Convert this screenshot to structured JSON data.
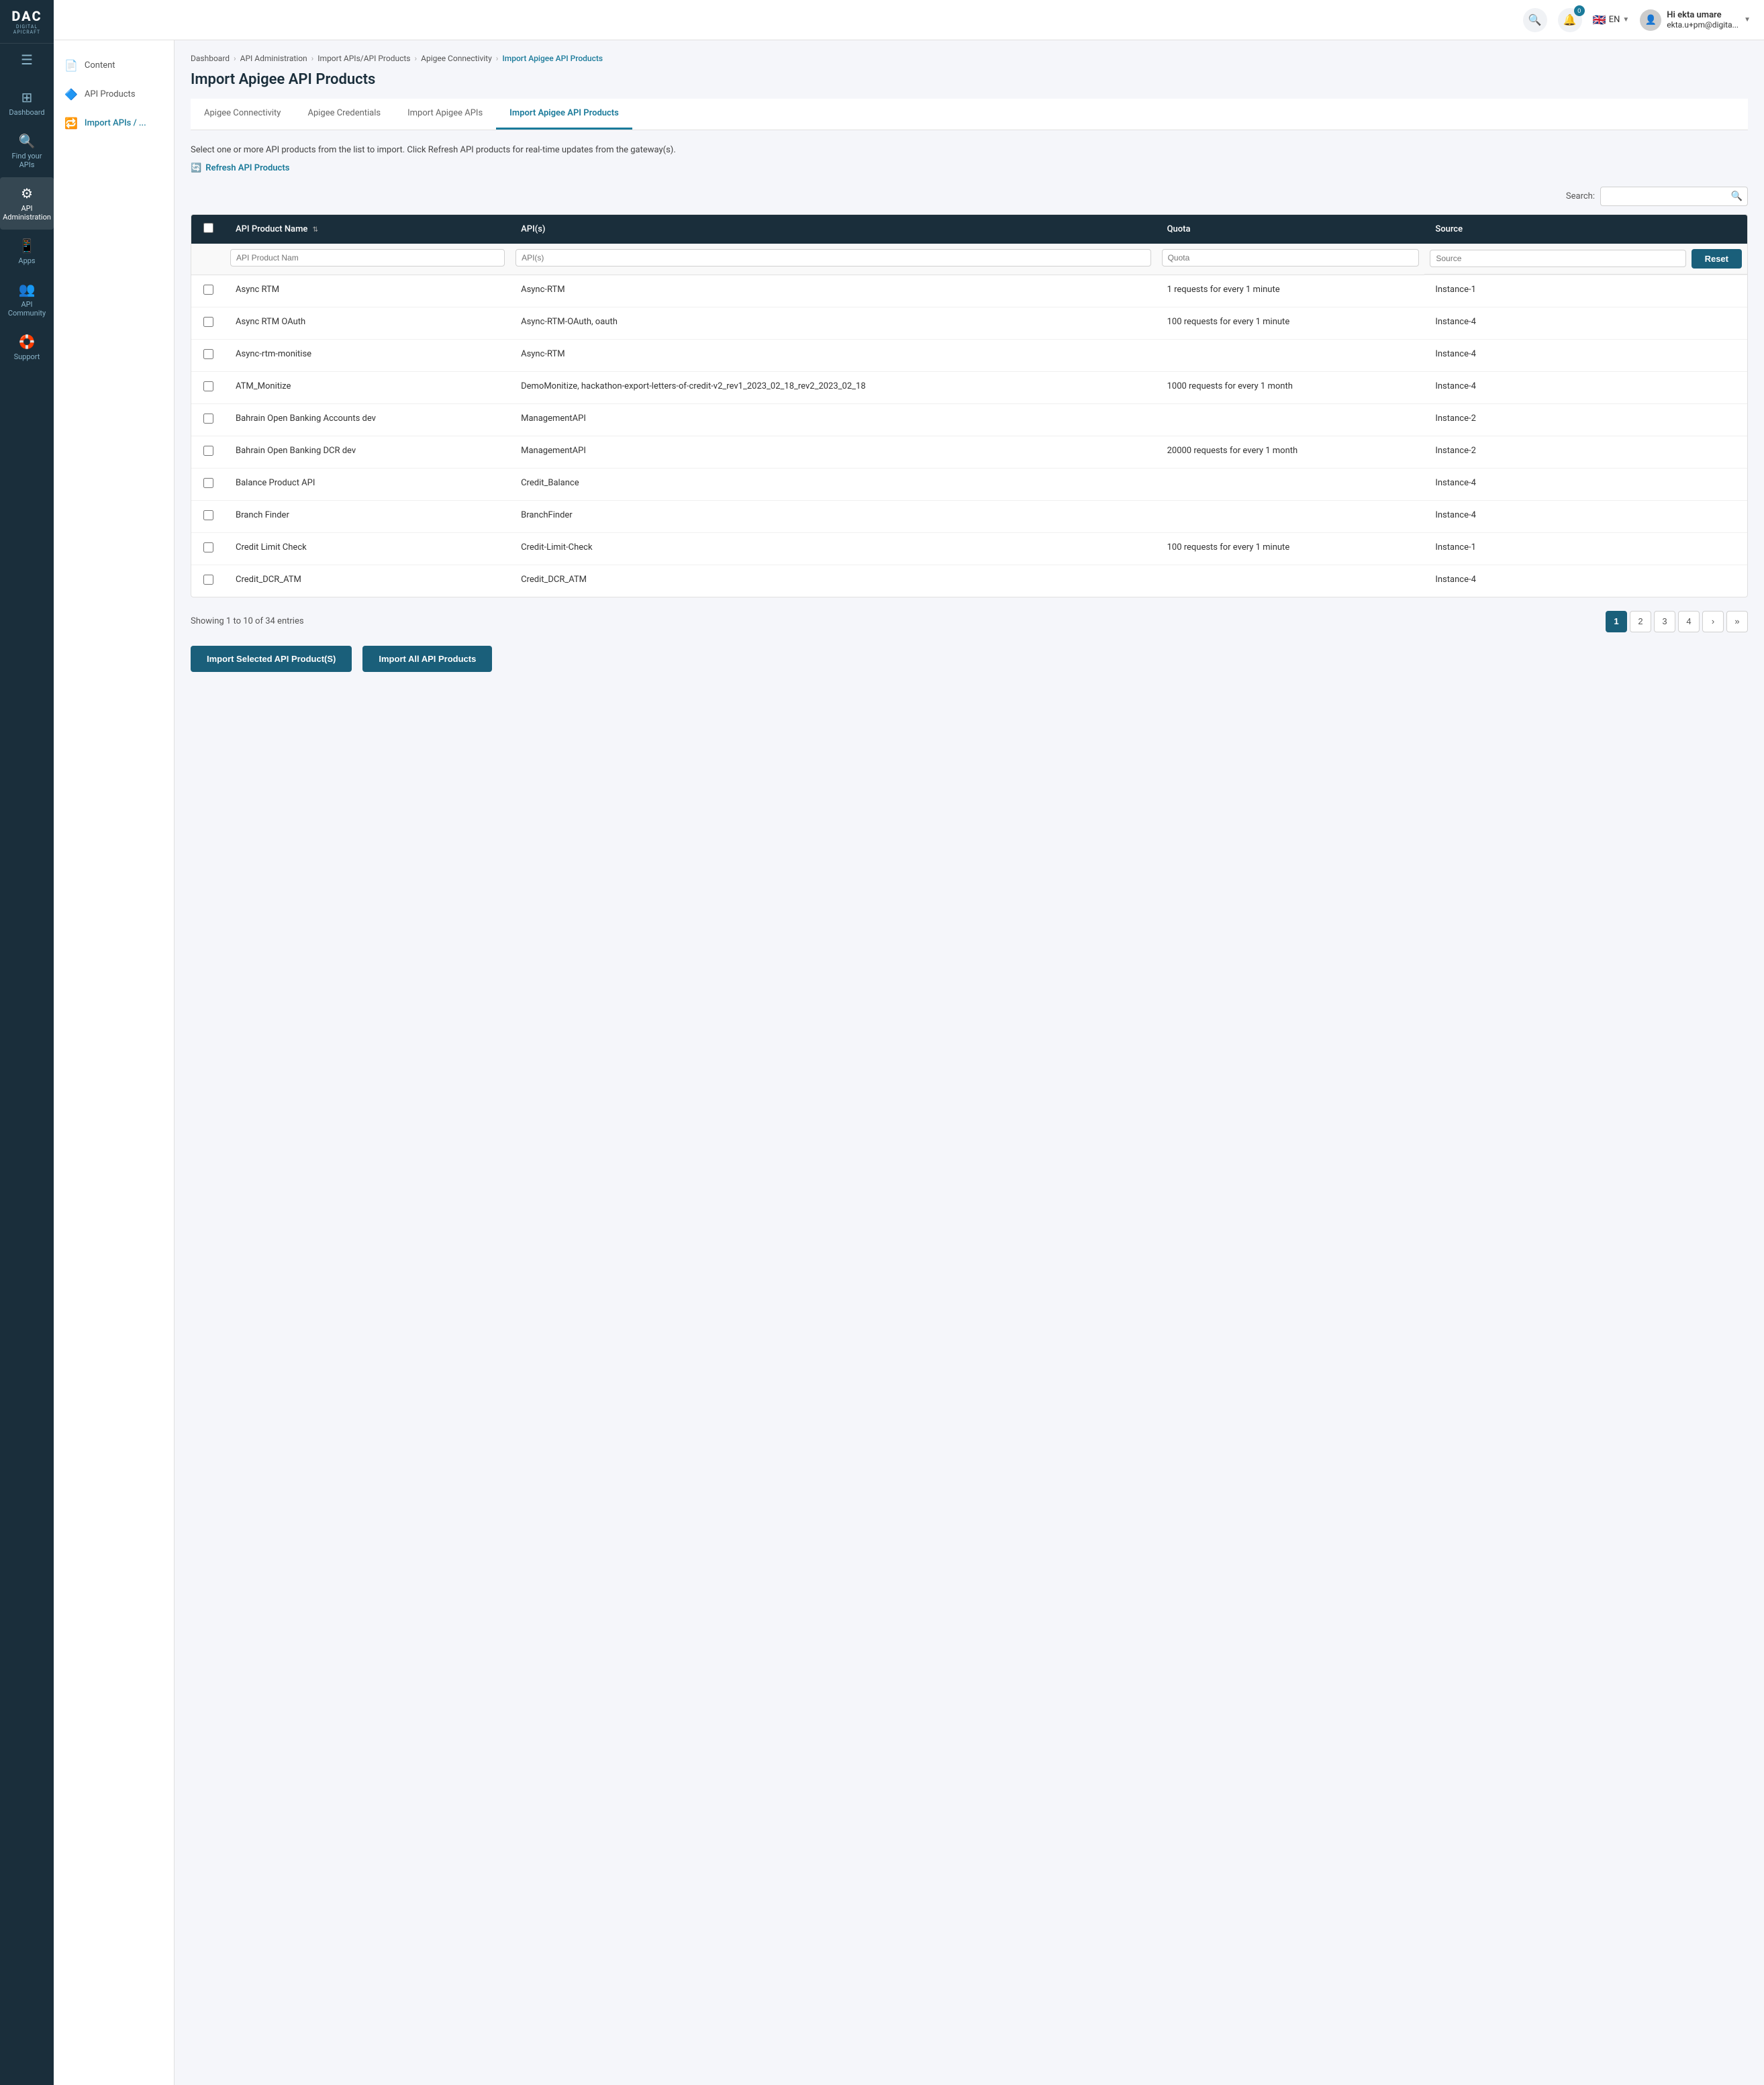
{
  "sidebar": {
    "logo": "DAC",
    "logo_sub": "DIGITAL APICRAFT",
    "items": [
      {
        "id": "dashboard",
        "label": "Dashboard",
        "icon": "⊞",
        "active": false
      },
      {
        "id": "find-apis",
        "label": "Find your APIs",
        "icon": "🔍",
        "active": false
      },
      {
        "id": "api-admin",
        "label": "API Administration",
        "icon": "⚙",
        "active": true
      },
      {
        "id": "apps",
        "label": "Apps",
        "icon": "📱",
        "active": false
      },
      {
        "id": "api-community",
        "label": "API Community",
        "icon": "👥",
        "active": false
      },
      {
        "id": "support",
        "label": "Support",
        "icon": "🛟",
        "active": false
      }
    ]
  },
  "second_sidebar": {
    "items": [
      {
        "id": "content",
        "label": "Content",
        "icon": "📄",
        "active": false
      },
      {
        "id": "api-products",
        "label": "API Products",
        "icon": "🔷",
        "active": false
      },
      {
        "id": "import-apis",
        "label": "Import APIs / ...",
        "icon": "🔁",
        "active": true
      }
    ]
  },
  "topnav": {
    "search_placeholder": "Search",
    "lang": "EN",
    "user_greeting": "Hi ekta umare",
    "user_email": "ekta.u+pm@digita..."
  },
  "breadcrumb": {
    "items": [
      "Dashboard",
      "API Administration",
      "Import APIs/API Products",
      "Apigee Connectivity"
    ],
    "current": "Import Apigee API Products"
  },
  "page_title": "Import Apigee API Products",
  "tabs": [
    {
      "id": "apigee-connectivity",
      "label": "Apigee Connectivity",
      "active": false
    },
    {
      "id": "apigee-credentials",
      "label": "Apigee Credentials",
      "active": false
    },
    {
      "id": "import-apigee-apis",
      "label": "Import Apigee APIs",
      "active": false
    },
    {
      "id": "import-apigee-api-products",
      "label": "Import Apigee API Products",
      "active": true
    }
  ],
  "info_text": "Select one or more API products from the list to import. Click Refresh API products for real-time updates from the gateway(s).",
  "refresh_label": "Refresh API Products",
  "search": {
    "label": "Search:",
    "placeholder": ""
  },
  "table": {
    "columns": [
      {
        "id": "checkbox",
        "label": "",
        "sortable": false
      },
      {
        "id": "api-product-name",
        "label": "API Product Name",
        "sortable": true
      },
      {
        "id": "apis",
        "label": "API(s)",
        "sortable": false
      },
      {
        "id": "quota",
        "label": "Quota",
        "sortable": false
      },
      {
        "id": "source",
        "label": "Source",
        "sortable": false
      }
    ],
    "filters": {
      "api_product_name": "API Product Nam",
      "apis": "API(s)",
      "quota": "Quota",
      "source": "Source",
      "reset_label": "Reset"
    },
    "rows": [
      {
        "id": 1,
        "name": "Async RTM",
        "apis": "Async-RTM",
        "quota": "1 requests for every 1 minute",
        "source": "Instance-1"
      },
      {
        "id": 2,
        "name": "Async RTM OAuth",
        "apis": "Async-RTM-OAuth, oauth",
        "quota": "100 requests for every 1 minute",
        "source": "Instance-4"
      },
      {
        "id": 3,
        "name": "Async-rtm-monitise",
        "apis": "Async-RTM",
        "quota": "",
        "source": "Instance-4"
      },
      {
        "id": 4,
        "name": "ATM_Monitize",
        "apis": "DemoMonitize, hackathon-export-letters-of-credit-v2_rev1_2023_02_18_rev2_2023_02_18",
        "quota": "1000 requests for every 1 month",
        "source": "Instance-4"
      },
      {
        "id": 5,
        "name": "Bahrain Open Banking Accounts dev",
        "apis": "ManagementAPI",
        "quota": "",
        "source": "Instance-2"
      },
      {
        "id": 6,
        "name": "Bahrain Open Banking DCR dev",
        "apis": "ManagementAPI",
        "quota": "20000 requests for every 1 month",
        "source": "Instance-2"
      },
      {
        "id": 7,
        "name": "Balance Product API",
        "apis": "Credit_Balance",
        "quota": "",
        "source": "Instance-4"
      },
      {
        "id": 8,
        "name": "Branch Finder",
        "apis": "BranchFinder",
        "quota": "",
        "source": "Instance-4"
      },
      {
        "id": 9,
        "name": "Credit Limit Check",
        "apis": "Credit-Limit-Check",
        "quota": "100 requests for every 1 minute",
        "source": "Instance-1"
      },
      {
        "id": 10,
        "name": "Credit_DCR_ATM",
        "apis": "Credit_DCR_ATM",
        "quota": "",
        "source": "Instance-4"
      }
    ]
  },
  "pagination": {
    "info": "Showing 1 to 10 of 34 entries",
    "pages": [
      "1",
      "2",
      "3",
      "4"
    ],
    "active_page": "1"
  },
  "buttons": {
    "import_selected": "Import Selected API Product(S)",
    "import_all": "Import All API Products"
  }
}
